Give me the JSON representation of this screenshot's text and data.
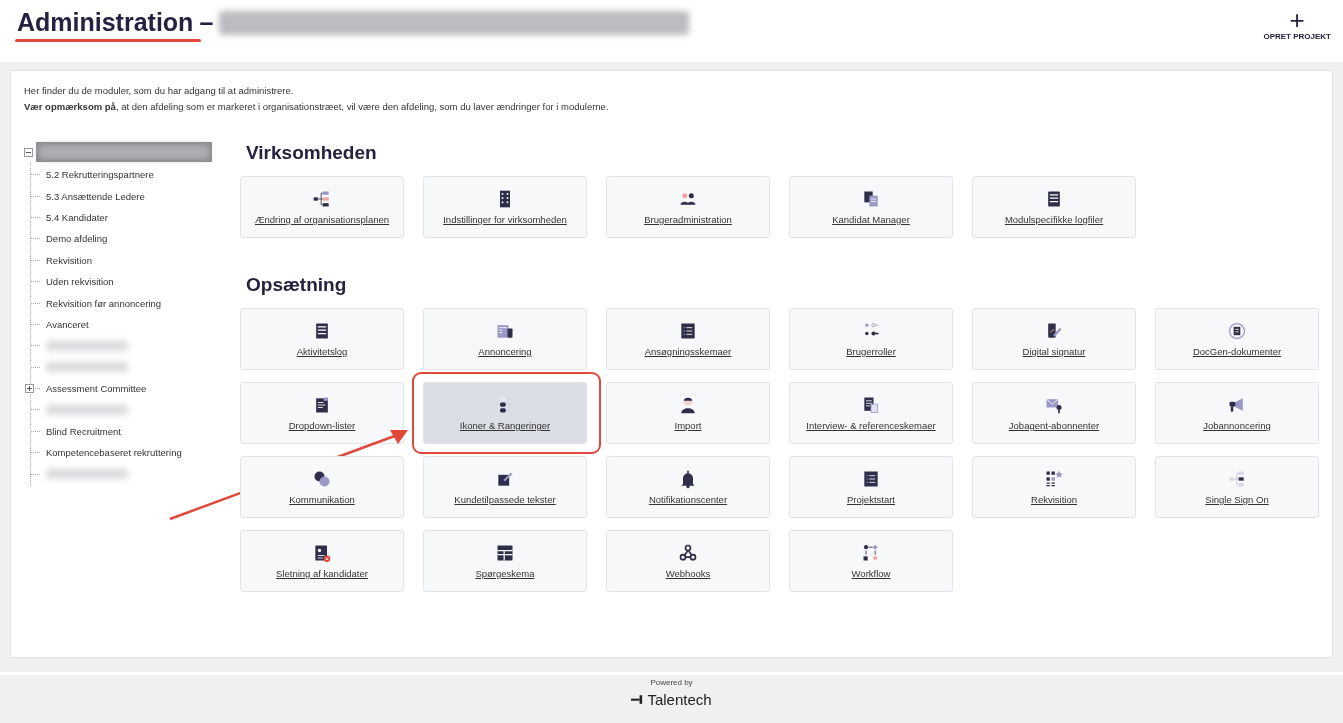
{
  "header": {
    "title": "Administration",
    "separator": "–",
    "title_underlined": true,
    "subtitle_redacted": true,
    "action": {
      "icon_text": "+",
      "label": "OPRET PROJEKT"
    }
  },
  "intro": {
    "line_1": "Her finder du de moduler, som du har adgang til at administrere.",
    "line_2": "**Vær opmærksom på**, at den afdeling som er markeret i organisationstræet, vil være den afdeling, som du laver ændringer for i modulerne."
  },
  "tree": {
    "root": {
      "redacted": true,
      "selected": true,
      "expanded": true
    },
    "children": [
      {
        "label": "5.2 Rekrutteringspartnere",
        "redacted": false
      },
      {
        "label": "5.3 Ansættende Ledere",
        "redacted": false
      },
      {
        "label": "5.4 Kandidater",
        "redacted": false
      },
      {
        "label": "Demo afdeling",
        "redacted": false
      },
      {
        "label": "Rekvisition",
        "redacted": false
      },
      {
        "label": "Uden rekvisition",
        "redacted": false
      },
      {
        "label": "Rekvisition før annoncering",
        "redacted": false
      },
      {
        "label": "Avanceret",
        "redacted": false
      },
      {
        "redacted": true
      },
      {
        "redacted": true
      },
      {
        "label": "Assessment Committee",
        "redacted": false,
        "expanded": false
      },
      {
        "redacted": true
      },
      {
        "label": "Blind Recruitment",
        "redacted": false
      },
      {
        "label": "Kompetencebaseret rekruttering",
        "redacted": false
      },
      {
        "redacted": true
      }
    ]
  },
  "sections": [
    {
      "title": "Virksomheden",
      "tiles": [
        {
          "label": "Ændring af organisationsplanen",
          "selected": false,
          "highlighted": false
        },
        {
          "label": "Indstillinger for virksomheden",
          "selected": false,
          "highlighted": false
        },
        {
          "label": "Brugeradministration",
          "selected": false,
          "highlighted": false
        },
        {
          "label": "Kandidat Manager",
          "selected": false,
          "highlighted": false
        },
        {
          "label": "Modulspecifikke logfiler",
          "selected": false,
          "highlighted": false
        }
      ]
    },
    {
      "title": "Opsætning",
      "tiles": [
        {
          "label": "Aktivitetslog",
          "selected": false,
          "highlighted": false
        },
        {
          "label": "Annoncering",
          "selected": false,
          "highlighted": false
        },
        {
          "label": "Ansøgningsskemaer",
          "selected": false,
          "highlighted": false
        },
        {
          "label": "Brugerroller",
          "selected": false,
          "highlighted": false
        },
        {
          "label": "Digital signatur",
          "selected": false,
          "highlighted": false
        },
        {
          "label": "DocGen-dokumenter",
          "selected": false,
          "highlighted": false
        },
        {
          "label": "Dropdown-lister",
          "selected": false,
          "highlighted": false
        },
        {
          "label": "Ikoner & Rangeringer",
          "selected": true,
          "highlighted": true
        },
        {
          "label": "Import",
          "selected": false,
          "highlighted": false
        },
        {
          "label": "Interview- & referenceskemaer",
          "selected": false,
          "highlighted": false
        },
        {
          "label": "Jobagent-abonnenter",
          "selected": false,
          "highlighted": false
        },
        {
          "label": "Jobannoncering",
          "selected": false,
          "highlighted": false
        },
        {
          "label": "Kommunikation",
          "selected": false,
          "highlighted": false
        },
        {
          "label": "Kundetilpassede tekster",
          "selected": false,
          "highlighted": false
        },
        {
          "label": "Notifikationscenter",
          "selected": false,
          "highlighted": false
        },
        {
          "label": "Projektstart",
          "selected": false,
          "highlighted": false
        },
        {
          "label": "Rekvisition",
          "selected": false,
          "highlighted": false
        },
        {
          "label": "Single Sign On",
          "selected": false,
          "highlighted": false
        },
        {
          "label": "Sletning af kandidater",
          "selected": false,
          "highlighted": false
        },
        {
          "label": "Spørgeskema",
          "selected": false,
          "highlighted": false
        },
        {
          "label": "Webhooks",
          "selected": false,
          "highlighted": false
        },
        {
          "label": "Workflow",
          "selected": false,
          "highlighted": false
        }
      ]
    }
  ],
  "footer": {
    "powered_by": "Powered by",
    "brand": "Talentech"
  }
}
